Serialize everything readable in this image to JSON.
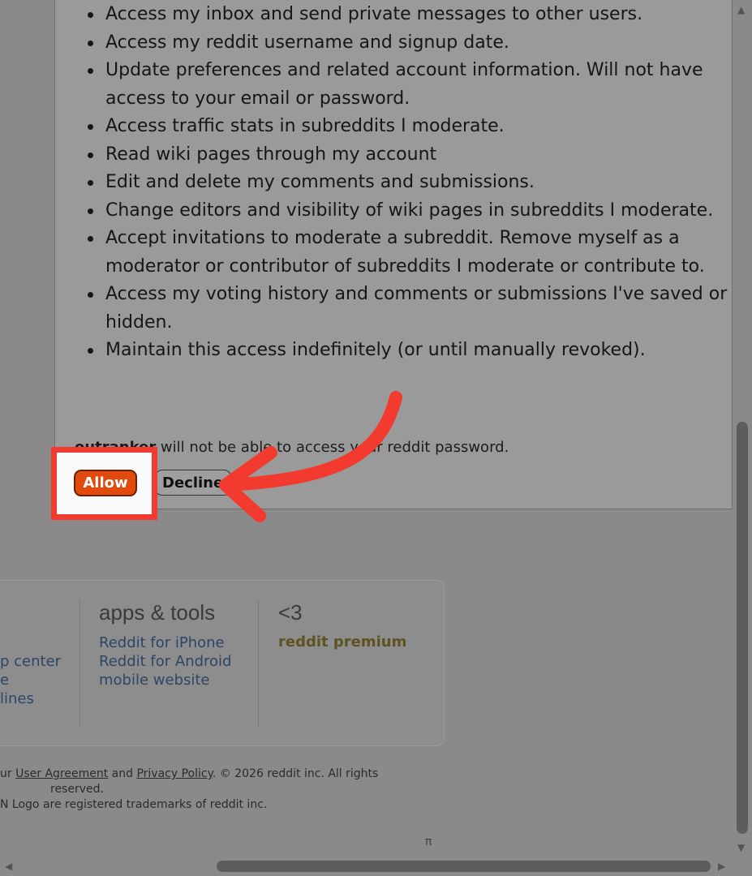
{
  "permissions": {
    "items": [
      "Access my inbox and send private messages to other users.",
      "Access my reddit username and signup date.",
      "Update preferences and related account information. Will not have access to your email or password.",
      "Access traffic stats in subreddits I moderate.",
      "Read wiki pages through my account",
      "Edit and delete my comments and submissions.",
      "Change editors and visibility of wiki pages in subreddits I moderate.",
      "Accept invitations to moderate a subreddit. Remove myself as a moderator or contributor of subreddits I moderate or contribute to.",
      "Access my voting history and comments or submissions I've saved or hidden.",
      "Maintain this access indefinitely (or until manually revoked)."
    ],
    "app_name": "outranker",
    "note_text": " will not be able to access your reddit password."
  },
  "buttons": {
    "allow": "Allow",
    "decline": "Decline"
  },
  "footer": {
    "col1_links": [
      "p center",
      "e",
      "lines"
    ],
    "apps_title": "apps & tools",
    "apps_links": [
      "Reddit for iPhone",
      "Reddit for Android",
      "mobile website"
    ],
    "heart_title": "<3",
    "premium": "reddit premium",
    "legal_prefix": "ur ",
    "user_agreement": "User Agreement",
    "and": " and ",
    "privacy_policy": "Privacy Policy",
    "legal_suffix": ". © 2026 reddit inc. All rights",
    "reserved": "reserved.",
    "trademark": "N Logo are registered trademarks of reddit inc.",
    "pi": "π"
  },
  "colors": {
    "highlight": "#f23a2e",
    "allow_button": "#e24a0d",
    "premium": "#5e5220",
    "link": "#2d4566"
  }
}
